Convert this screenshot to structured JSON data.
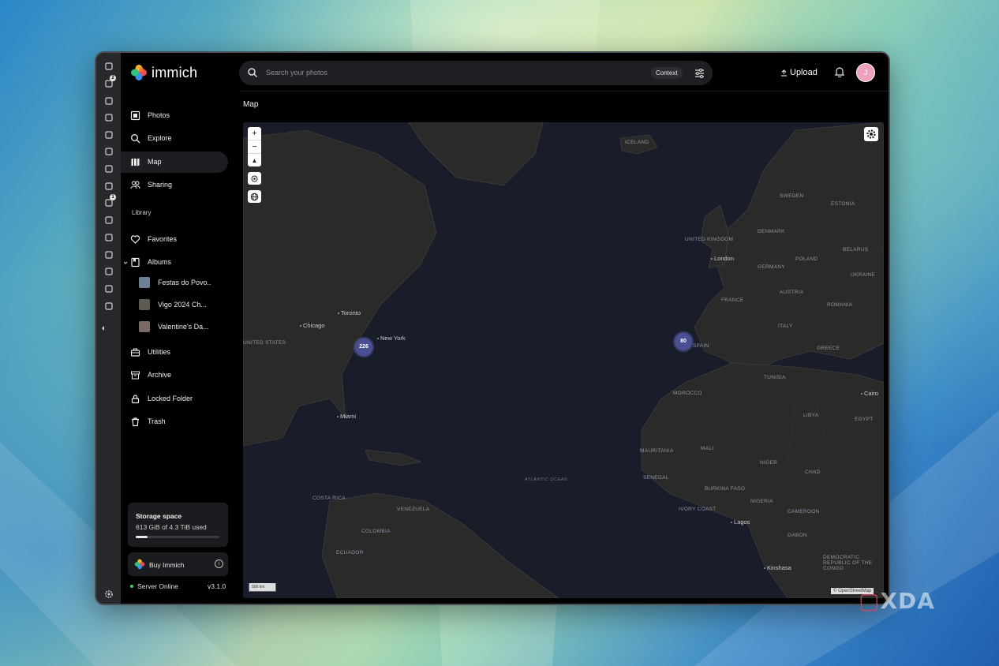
{
  "app": {
    "name": "immich"
  },
  "search": {
    "placeholder": "Search your photos",
    "context_label": "Context"
  },
  "header": {
    "upload_label": "Upload",
    "avatar_initial": "J"
  },
  "side_panel": {
    "icons": [
      {
        "name": "bookmark-icon",
        "badge": ""
      },
      {
        "name": "tabs-icon",
        "badge": "2"
      },
      {
        "name": "download-icon",
        "badge": ""
      },
      {
        "name": "history-icon",
        "badge": ""
      },
      {
        "name": "edit-icon",
        "badge": ""
      },
      {
        "name": "chart-icon",
        "badge": ""
      },
      {
        "name": "calendar-icon",
        "badge": ""
      },
      {
        "name": "chat-icon",
        "badge": ""
      },
      {
        "name": "notes-icon",
        "badge": "1"
      },
      {
        "name": "wallet-icon",
        "badge": ""
      },
      {
        "name": "bluesky-icon",
        "badge": ""
      },
      {
        "name": "reddit-icon",
        "badge": ""
      },
      {
        "name": "reader-icon",
        "badge": ""
      },
      {
        "name": "shield-icon",
        "badge": ""
      },
      {
        "name": "add-panel-icon",
        "badge": ""
      }
    ]
  },
  "nav": {
    "items": [
      {
        "label": "Photos",
        "icon": "photos-icon",
        "active": false
      },
      {
        "label": "Explore",
        "icon": "explore-icon",
        "active": false
      },
      {
        "label": "Map",
        "icon": "map-icon",
        "active": true
      },
      {
        "label": "Sharing",
        "icon": "sharing-icon",
        "active": false
      }
    ],
    "library_label": "Library",
    "library": [
      {
        "label": "Favorites",
        "icon": "heart-icon"
      },
      {
        "label": "Albums",
        "icon": "albums-icon"
      }
    ],
    "albums": [
      {
        "label": "Festas do Povo...",
        "thumb": "#6d7f95"
      },
      {
        "label": "Vigo 2024 Ch...",
        "thumb": "#5c5a52"
      },
      {
        "label": "Valentine's Da...",
        "thumb": "#7a6a68"
      }
    ],
    "more": [
      {
        "label": "Utilities",
        "icon": "utilities-icon"
      },
      {
        "label": "Archive",
        "icon": "archive-icon"
      },
      {
        "label": "Locked Folder",
        "icon": "lock-icon"
      },
      {
        "label": "Trash",
        "icon": "trash-icon"
      }
    ]
  },
  "storage": {
    "title": "Storage space",
    "usage": "613 GiB of 4.3 TiB used",
    "fraction": 0.14
  },
  "buy": {
    "label": "Buy Immich"
  },
  "server": {
    "status": "Server Online",
    "version": "v3.1.0"
  },
  "page": {
    "title": "Map"
  },
  "map": {
    "clusters": [
      {
        "count": "226"
      },
      {
        "count": "80"
      }
    ],
    "country_labels": [
      "ICELAND",
      "SWEDEN",
      "ESTONIA",
      "DENMARK",
      "UNITED KINGDOM",
      "BELARUS",
      "GERMANY",
      "POLAND",
      "UKRAINE",
      "FRANCE",
      "AUSTRIA",
      "ROMANIA",
      "ITALY",
      "GREECE",
      "SPAIN",
      "UNITED STATES",
      "MOROCCO",
      "TUNISIA",
      "LIBYA",
      "EGYPT",
      "MAURITANIA",
      "MALI",
      "NIGER",
      "CHAD",
      "SENEGAL",
      "BURKINA FASO",
      "NIGERIA",
      "IVORY COAST",
      "CAMEROON",
      "COSTA RICA",
      "VENEZUELA",
      "COLOMBIA",
      "ECUADOR",
      "GABON",
      "DEMOCRATIC REPUBLIC OF THE CONGO"
    ],
    "city_labels": [
      "London",
      "Toronto",
      "Chicago",
      "New York",
      "Miami",
      "Cairo",
      "Lagos",
      "Kinshasa"
    ],
    "ocean_label": "ATLANTIC OCEAN",
    "scale_label": "500 km",
    "attribution": "© OpenStreetMap"
  },
  "watermark": {
    "text": "XDA"
  }
}
